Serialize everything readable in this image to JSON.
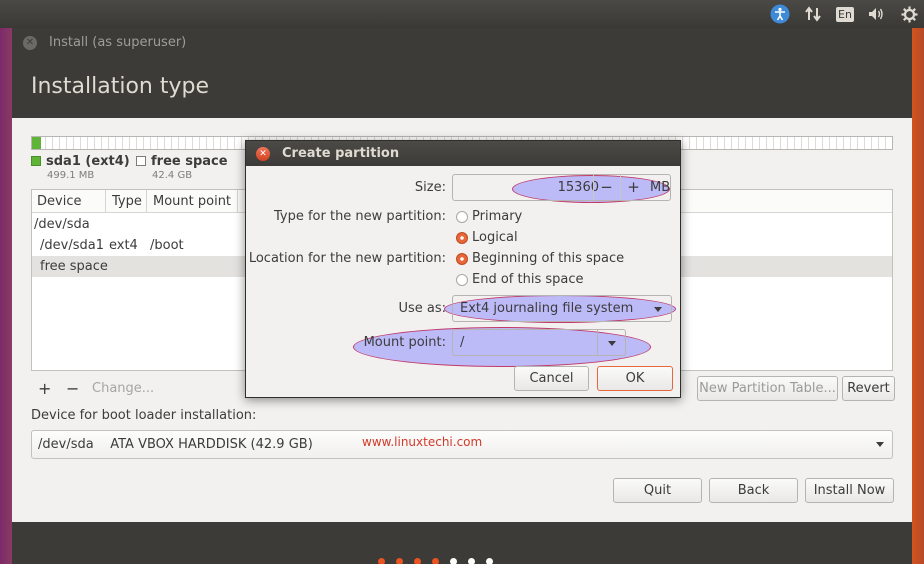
{
  "window": {
    "title": "Install (as superuser)",
    "page_title": "Installation type"
  },
  "tray": {
    "lang": "En"
  },
  "legend": [
    {
      "name": "sda1 (ext4)",
      "size": "499.1 MB",
      "color": "#5fb336"
    },
    {
      "name": "free space",
      "size": "42.4 GB",
      "color": "#ffffff"
    }
  ],
  "table": {
    "headers": [
      "Device",
      "Type",
      "Mount point"
    ],
    "rows": [
      {
        "device": "/dev/sda",
        "type": "",
        "mount": ""
      },
      {
        "device": "/dev/sda1",
        "type": "ext4",
        "mount": "/boot"
      },
      {
        "device": "free space",
        "type": "",
        "mount": ""
      }
    ]
  },
  "toolbar": {
    "add": "+",
    "remove": "−",
    "change": "Change...",
    "new_table": "New Partition Table...",
    "revert": "Revert"
  },
  "bootloader": {
    "label": "Device for boot loader installation:",
    "value": "/dev/sda    ATA VBOX HARDDISK (42.9 GB)"
  },
  "watermark": "www.linuxtechi.com",
  "nav": {
    "quit": "Quit",
    "back": "Back",
    "install": "Install Now"
  },
  "dialog": {
    "title": "Create partition",
    "size_label": "Size:",
    "size_value": "15360",
    "size_minus": "−",
    "size_plus": "+",
    "size_unit": "MB",
    "type_label": "Type for the new partition:",
    "type_options": [
      "Primary",
      "Logical"
    ],
    "type_selected": "Logical",
    "location_label": "Location for the new partition:",
    "location_options": [
      "Beginning of this space",
      "End of this space"
    ],
    "location_selected": "Beginning of this space",
    "use_as_label": "Use as:",
    "use_as_value": "Ext4 journaling file system",
    "mount_label": "Mount point:",
    "mount_value": "/",
    "cancel": "Cancel",
    "ok": "OK"
  },
  "colors": {
    "accent": "#e5673b",
    "highlight": "#918cff",
    "used_partition": "#5fb336"
  }
}
